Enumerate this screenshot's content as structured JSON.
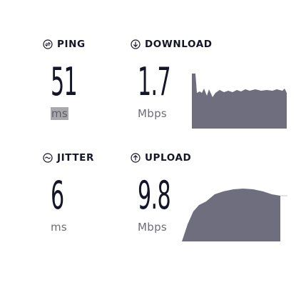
{
  "ping": {
    "label": "PING",
    "value": "51",
    "unit": "ms",
    "icon": "ping-icon"
  },
  "download": {
    "label": "DOWNLOAD",
    "value": "1.7",
    "unit": "Mbps",
    "icon": "download-arrow-icon",
    "graph": {
      "color": "#6f6e7e"
    }
  },
  "jitter": {
    "label": "JITTER",
    "value": "6",
    "unit": "ms",
    "icon": "jitter-icon"
  },
  "upload": {
    "label": "UPLOAD",
    "value": "9.8",
    "unit": "Mbps",
    "icon": "upload-arrow-icon",
    "graph": {
      "color": "#6f6e7e"
    }
  }
}
